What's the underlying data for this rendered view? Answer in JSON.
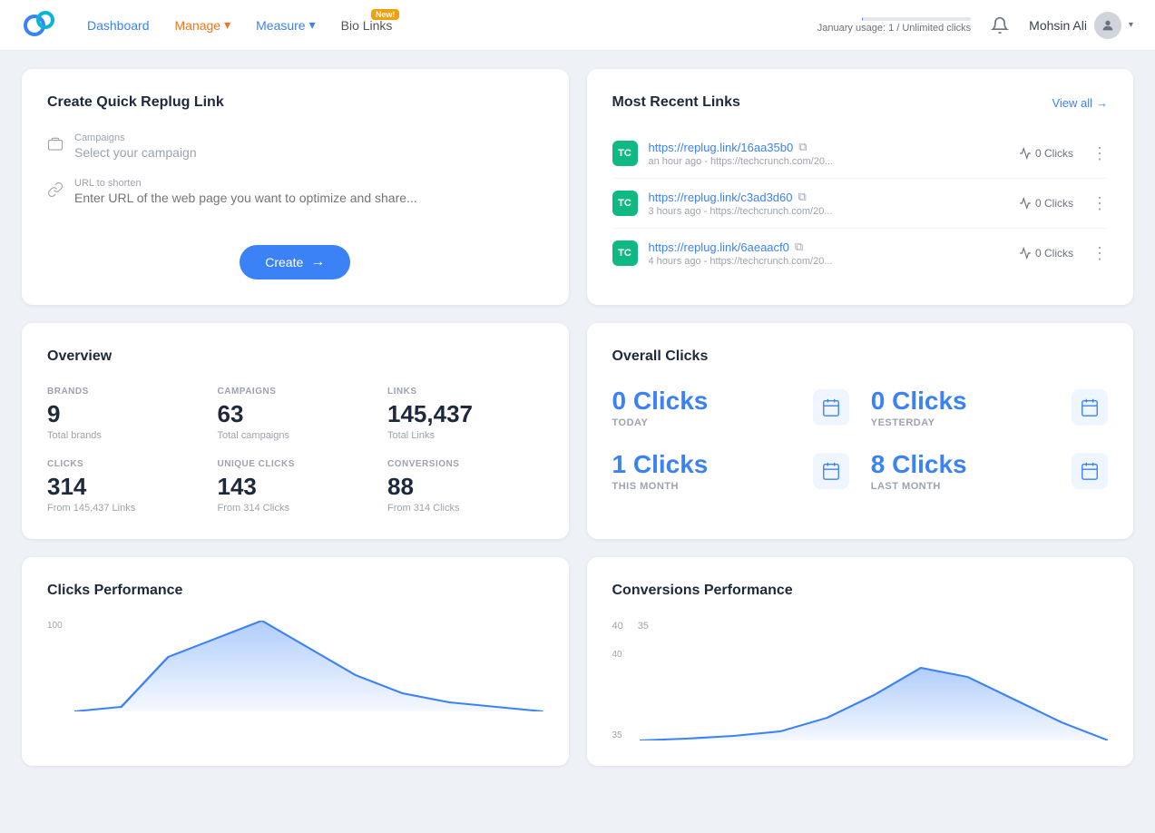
{
  "app": {
    "logo_text": "Replug"
  },
  "navbar": {
    "dashboard_label": "Dashboard",
    "manage_label": "Manage",
    "measure_label": "Measure",
    "bio_links_label": "Bio Links",
    "bio_links_badge": "New!",
    "usage_text": "January usage: 1 / Unlimited clicks",
    "usage_fill_percent": 1,
    "user_name": "Mohsin Ali",
    "view_all_label": "View all"
  },
  "create_link": {
    "title": "Create Quick Replug Link",
    "campaigns_label": "Campaigns",
    "campaigns_placeholder": "Select your campaign",
    "url_label": "URL to shorten",
    "url_placeholder": "Enter URL of the web page you want to optimize and share...",
    "create_button": "Create"
  },
  "most_recent": {
    "title": "Most Recent Links",
    "view_all": "View all",
    "links": [
      {
        "favicon_text": "TC",
        "url": "https://replug.link/16aa35b0",
        "meta": "an hour ago - https://techcrunch.com/20...",
        "clicks_label": "0 Clicks"
      },
      {
        "favicon_text": "TC",
        "url": "https://replug.link/c3ad3d60",
        "meta": "3 hours ago - https://techcrunch.com/20...",
        "clicks_label": "0 Clicks"
      },
      {
        "favicon_text": "TC",
        "url": "https://replug.link/6aeaacf0",
        "meta": "4 hours ago - https://techcrunch.com/20...",
        "clicks_label": "0 Clicks"
      }
    ]
  },
  "overview": {
    "title": "Overview",
    "stats": [
      {
        "label": "BRANDS",
        "value": "9",
        "sub": "Total brands"
      },
      {
        "label": "CAMPAIGNS",
        "value": "63",
        "sub": "Total campaigns"
      },
      {
        "label": "LINKS",
        "value": "145,437",
        "sub": "Total Links"
      },
      {
        "label": "CLICKS",
        "value": "314",
        "sub": "From 145,437 Links"
      },
      {
        "label": "UNIQUE CLICKS",
        "value": "143",
        "sub": "From 314 Clicks"
      },
      {
        "label": "CONVERSIONS",
        "value": "88",
        "sub": "From 314 Clicks"
      }
    ]
  },
  "overall_clicks": {
    "title": "Overall Clicks",
    "stats": [
      {
        "value": "0 Clicks",
        "label": "TODAY"
      },
      {
        "value": "0 Clicks",
        "label": "YESTERDAY"
      },
      {
        "value": "1 Clicks",
        "label": "THIS MONTH"
      },
      {
        "value": "8 Clicks",
        "label": "LAST MONTH"
      }
    ]
  },
  "clicks_performance": {
    "title": "Clicks Performance",
    "y_labels": [
      "100",
      ""
    ],
    "chart_data": [
      0,
      5,
      60,
      80,
      100,
      70,
      40,
      20,
      10,
      5,
      0
    ]
  },
  "conversions_performance": {
    "title": "Conversions Performance",
    "y_labels": [
      "40",
      "35"
    ],
    "chart_data": [
      0,
      2,
      5,
      10,
      20,
      30,
      38,
      35,
      25,
      15,
      5
    ]
  }
}
